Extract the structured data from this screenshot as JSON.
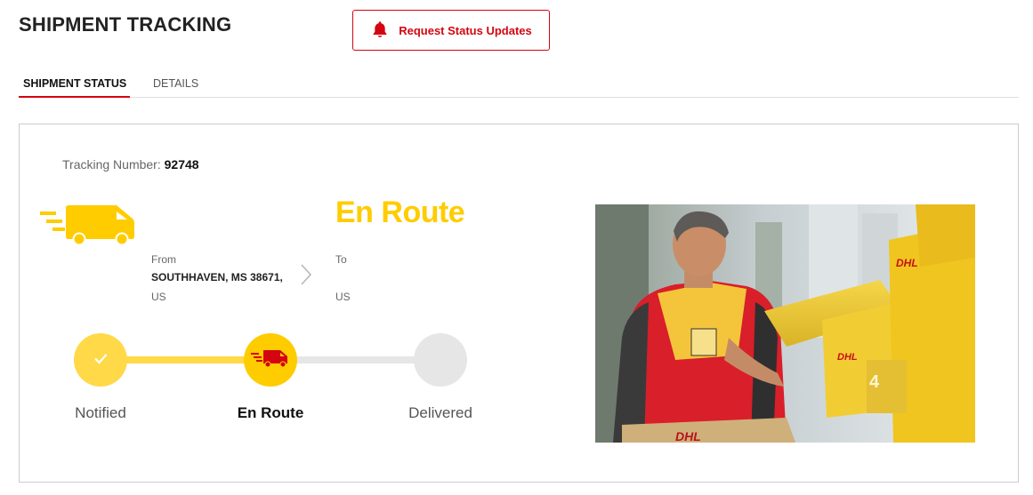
{
  "header": {
    "title": "SHIPMENT TRACKING",
    "request_button_label": "Request Status Updates",
    "bell_icon": "bell-icon",
    "accent_color": "#d40511"
  },
  "tabs": [
    {
      "label": "SHIPMENT STATUS",
      "active": true
    },
    {
      "label": "DETAILS",
      "active": false
    }
  ],
  "tracking": {
    "label": "Tracking Number:",
    "number": "92748"
  },
  "shipment": {
    "status": "En Route",
    "status_color": "#ffcc00",
    "from_label": "From",
    "from_address": "SOUTHHAVEN, MS 38671,",
    "from_country": "US",
    "to_label": "To",
    "to_country": "US"
  },
  "progress": {
    "steps": [
      {
        "label": "Notified",
        "state": "done",
        "icon": "check-icon"
      },
      {
        "label": "En Route",
        "state": "current",
        "icon": "truck-icon"
      },
      {
        "label": "Delivered",
        "state": "pending",
        "icon": ""
      }
    ]
  }
}
